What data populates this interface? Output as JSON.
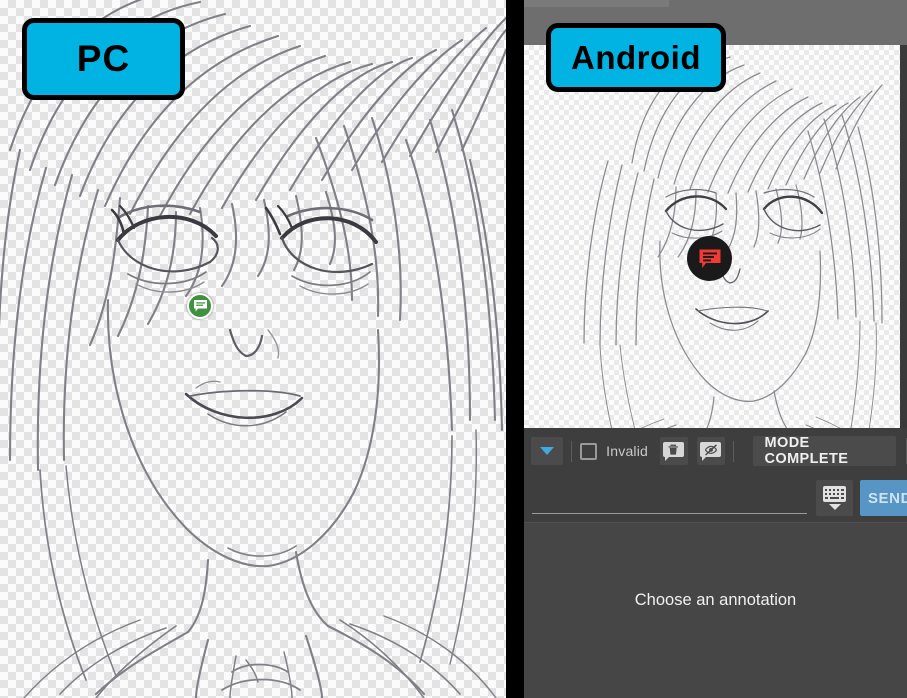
{
  "panes": {
    "pc": {
      "badge_label": "PC",
      "marker": {
        "name": "annotation-marker-green",
        "color": "#3f9140"
      }
    },
    "android": {
      "badge_label": "Android",
      "marker": {
        "name": "annotation-marker-red",
        "color": "#ef3b33"
      }
    }
  },
  "badge": {
    "fill_color": "#00b3e3",
    "border_color": "#000000"
  },
  "toolbar": {
    "dropdown_icon": "chevron-down-icon",
    "dropdown_color": "#3fa9e0",
    "invalid_label": "Invalid",
    "invalid_checked": false,
    "delete_icon": "comment-delete-icon",
    "hide_icon": "comment-hide-icon",
    "mode_complete_label": "MODE COMPLETE"
  },
  "input_row": {
    "message_value": "",
    "message_placeholder": "",
    "keyboard_icon": "keyboard-hide-icon",
    "send_label": "SEND",
    "send_color": "#5695c4"
  },
  "annotation_panel": {
    "empty_text": "Choose an annotation"
  }
}
